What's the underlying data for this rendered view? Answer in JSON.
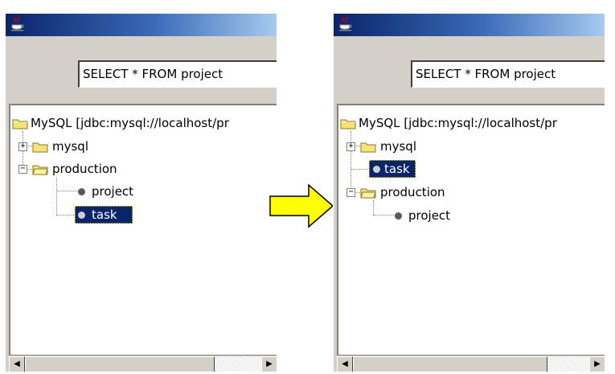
{
  "left_window": {
    "query": "SELECT * FROM project",
    "tree": {
      "root": "MySQL [jdbc:mysql://localhost/pr",
      "items": [
        "mysql",
        "production",
        "project",
        "task"
      ]
    }
  },
  "right_window": {
    "query": "SELECT * FROM project",
    "tree": {
      "root": "MySQL [jdbc:mysql://localhost/pr",
      "items": [
        "mysql",
        "task",
        "production",
        "project"
      ]
    }
  },
  "colors": {
    "title_bar": "#0a246a",
    "selection": "#0a246a",
    "arrow_fill": "#ffff00",
    "window_bg": "#d4d0c8"
  },
  "icons": {
    "title": "java-cup-icon",
    "folder": "folder-icon",
    "table": "table-bullet-icon",
    "scroll_left": "scroll-left-arrow-icon",
    "scroll_right": "scroll-right-arrow-icon",
    "transition": "right-arrow-icon"
  }
}
